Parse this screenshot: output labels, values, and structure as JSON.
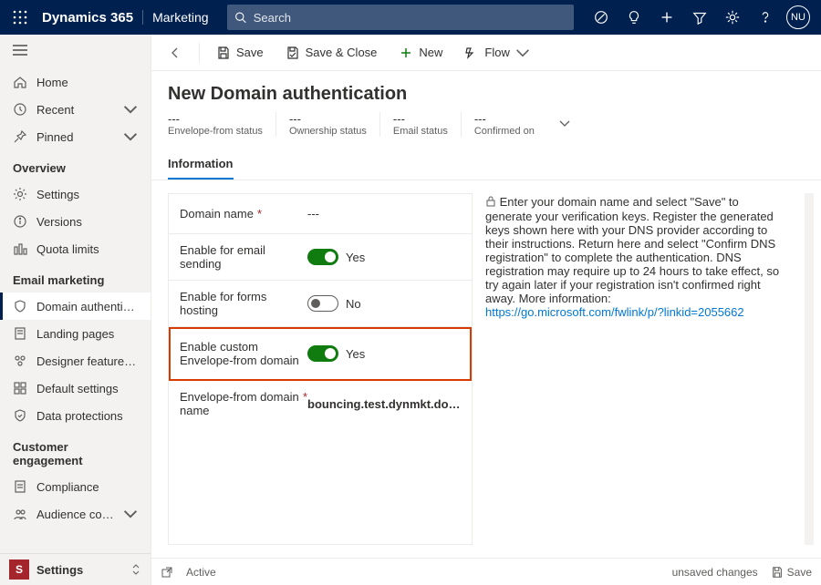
{
  "header": {
    "app": "Dynamics 365",
    "subapp": "Marketing",
    "search_placeholder": "Search",
    "avatar": "NU"
  },
  "sidebar": {
    "home": "Home",
    "recent": "Recent",
    "pinned": "Pinned",
    "section1": "Overview",
    "settings": "Settings",
    "versions": "Versions",
    "quota": "Quota limits",
    "section2": "Email marketing",
    "domain_auth": "Domain authentic…",
    "landing": "Landing pages",
    "designer": "Designer feature …",
    "defaults": "Default settings",
    "dataprot": "Data protections",
    "section3": "Customer engagement",
    "compliance": "Compliance",
    "audience": "Audience configur…",
    "area_badge": "S",
    "area_label": "Settings"
  },
  "toolbar": {
    "save": "Save",
    "save_close": "Save & Close",
    "new": "New",
    "flow": "Flow"
  },
  "page": {
    "title": "New Domain authentication",
    "status": {
      "envelope": {
        "val": "---",
        "label": "Envelope-from status"
      },
      "ownership": {
        "val": "---",
        "label": "Ownership status"
      },
      "email": {
        "val": "---",
        "label": "Email status"
      },
      "confirmed": {
        "val": "---",
        "label": "Confirmed on"
      }
    },
    "tab": "Information"
  },
  "form": {
    "domain_name": {
      "label": "Domain name",
      "value": "---"
    },
    "email_send": {
      "label": "Enable for email sending",
      "value": "Yes"
    },
    "forms": {
      "label": "Enable for forms hosting",
      "value": "No"
    },
    "custom_env": {
      "label": "Enable custom Envelope-from domain",
      "value": "Yes"
    },
    "env_domain": {
      "label": "Envelope-from domain name",
      "value": "bouncing.test.dynmkt.do…"
    }
  },
  "help": {
    "text": "Enter your domain name and select \"Save\" to generate your verification keys. Register the generated keys shown here with your DNS provider according to their instructions. Return here and select \"Confirm DNS registration\" to complete the authentication. DNS registration may require up to 24 hours to take effect, so try again later if your registration isn't confirmed right away. More information:",
    "link": "https://go.microsoft.com/fwlink/p/?linkid=2055662"
  },
  "footer": {
    "active": "Active",
    "unsaved": "unsaved changes",
    "save": "Save"
  }
}
